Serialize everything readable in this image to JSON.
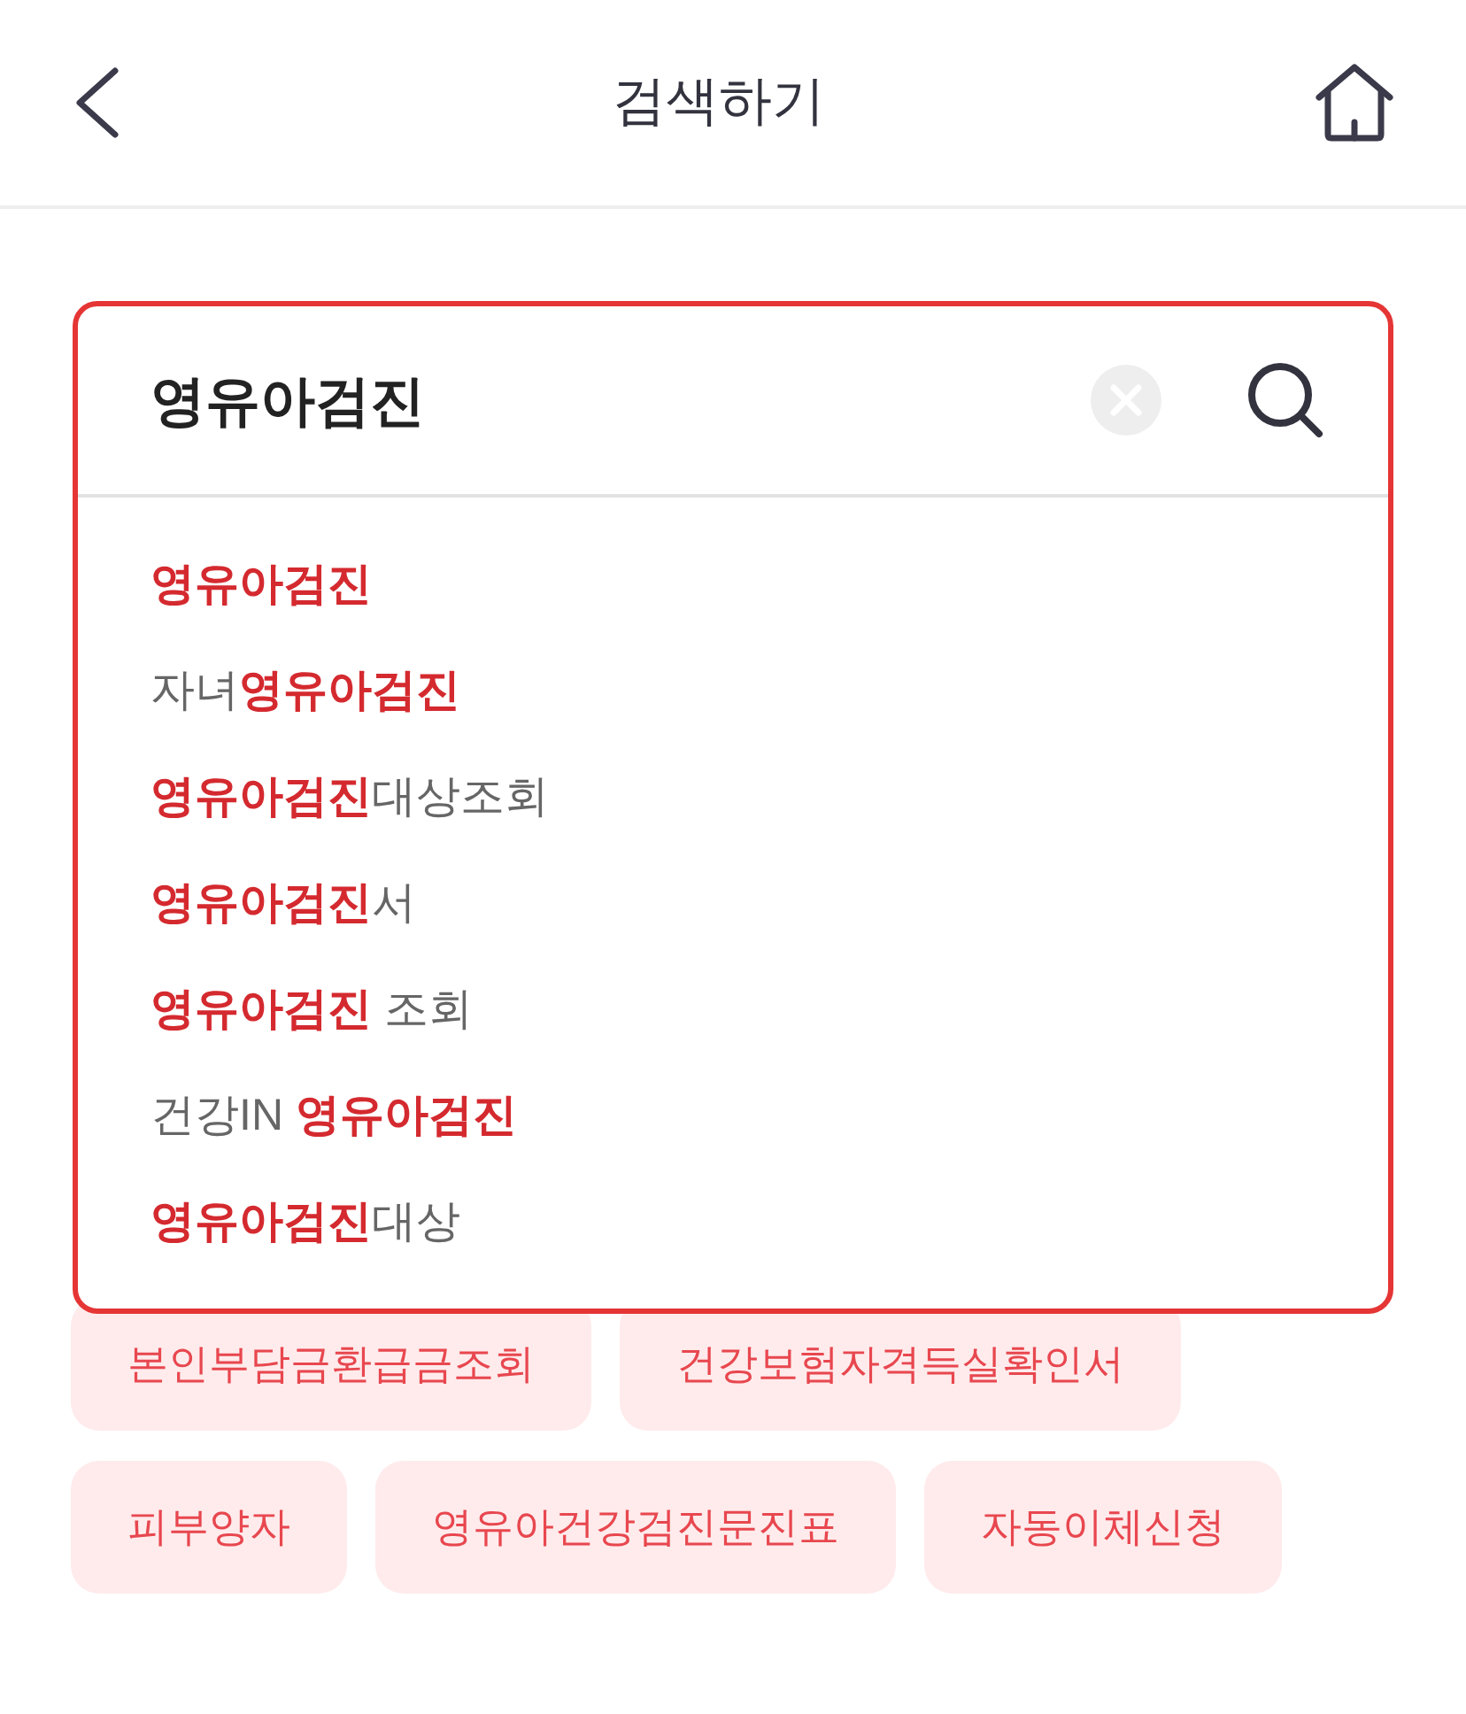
{
  "header": {
    "title": "검색하기"
  },
  "search": {
    "value": "영유아검진"
  },
  "suggestions": [
    {
      "segments": [
        {
          "text": "영유아검진",
          "highlight": true
        }
      ]
    },
    {
      "segments": [
        {
          "text": "자녀",
          "highlight": false
        },
        {
          "text": "영유아검진",
          "highlight": true
        }
      ]
    },
    {
      "segments": [
        {
          "text": "영유아검진",
          "highlight": true
        },
        {
          "text": "대상조회",
          "highlight": false
        }
      ]
    },
    {
      "segments": [
        {
          "text": "영유아검진",
          "highlight": true
        },
        {
          "text": "서",
          "highlight": false
        }
      ]
    },
    {
      "segments": [
        {
          "text": "영유아검진",
          "highlight": true
        },
        {
          "text": " 조회",
          "highlight": false
        }
      ]
    },
    {
      "segments": [
        {
          "text": "건강IN ",
          "highlight": false
        },
        {
          "text": "영유아검진",
          "highlight": true
        }
      ]
    },
    {
      "segments": [
        {
          "text": "영유아검진",
          "highlight": true
        },
        {
          "text": "대상",
          "highlight": false
        }
      ]
    }
  ],
  "tags": [
    {
      "label": "본인부담금환급금조회"
    },
    {
      "label": "건강보험자격득실확인서"
    },
    {
      "label": "피부양자"
    },
    {
      "label": "영유아건강검진문진표"
    },
    {
      "label": "자동이체신청"
    }
  ]
}
